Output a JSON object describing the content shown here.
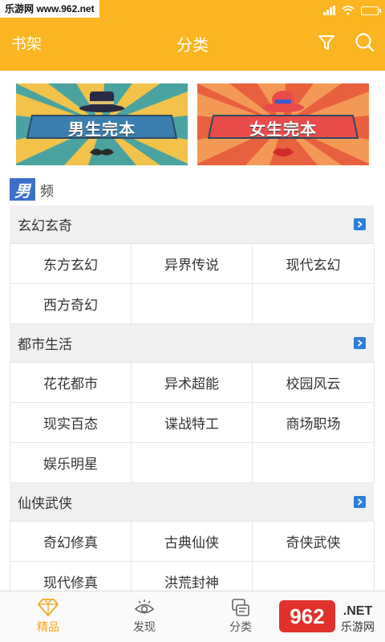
{
  "watermark": "乐游网 www.962.net",
  "nav": {
    "left_label": "书架",
    "title": "分类",
    "filter_icon": "filter-icon",
    "search_icon": "search-icon"
  },
  "banners": [
    {
      "label": "男生完本",
      "accent": "#4a90b8"
    },
    {
      "label": "女生完本",
      "accent": "#e8584a"
    }
  ],
  "frequency": {
    "badge": "男",
    "text": "频"
  },
  "categories": [
    {
      "title": "玄幻玄奇",
      "items": [
        "东方玄幻",
        "异界传说",
        "现代玄幻",
        "西方奇幻",
        "",
        ""
      ]
    },
    {
      "title": "都市生活",
      "items": [
        "花花都市",
        "异术超能",
        "校园风云",
        "现实百态",
        "谍战特工",
        "商场职场",
        "娱乐明星",
        "",
        ""
      ]
    },
    {
      "title": "仙侠武侠",
      "items": [
        "奇幻修真",
        "古典仙侠",
        "奇侠武侠",
        "现代修真",
        "洪荒封神",
        ""
      ]
    }
  ],
  "tabs": [
    {
      "label": "精品",
      "icon": "diamond-icon",
      "active": true
    },
    {
      "label": "发现",
      "icon": "eye-icon",
      "active": false
    },
    {
      "label": "分类",
      "icon": "category-icon",
      "active": false
    }
  ],
  "logo": {
    "brand": "962",
    "net": ".NET",
    "sub": "乐游网"
  },
  "colors": {
    "header": "#fbb520",
    "accent": "#f5a623",
    "male_badge": "#3d6fc9"
  }
}
